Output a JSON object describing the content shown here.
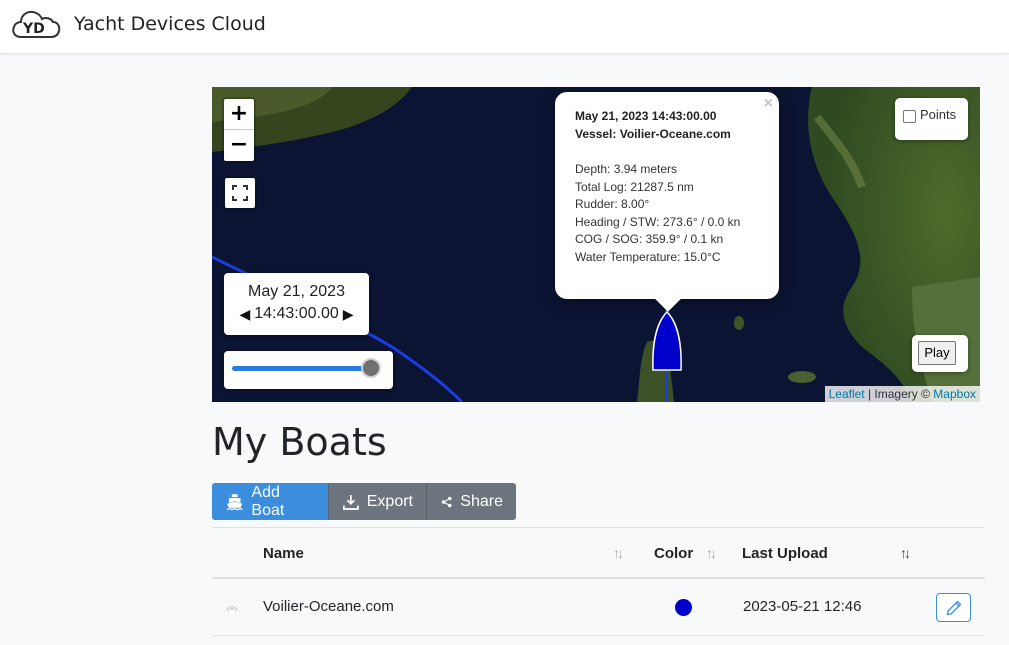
{
  "header": {
    "logo_text": "YD",
    "app_title": "Yacht Devices Cloud"
  },
  "map": {
    "zoom_in": "+",
    "zoom_out": "−",
    "time_control": {
      "date": "May 21, 2023",
      "time": "14:43:00.00",
      "prev": "◀",
      "next": "▶"
    },
    "slider": {
      "value_fraction": 1.0
    },
    "popup": {
      "close": "×",
      "datetime": "May 21, 2023 14:43:00.00",
      "vessel": "Vessel: Voilier-Oceane.com",
      "lines": [
        "Depth: 3.94 meters",
        "Total Log: 21287.5 nm",
        "Rudder: 8.00°",
        "Heading / STW: 273.6° / 0.0 kn",
        "COG / SOG: 359.9° / 0.1 kn",
        "Water Temperature: 15.0°C"
      ]
    },
    "points_label": "Points",
    "play_label": "Play",
    "attribution": {
      "leaflet": "Leaflet",
      "sep": " | Imagery © ",
      "mapbox": "Mapbox"
    },
    "boat_color": "#0000cc",
    "track_color": "#1a3de0"
  },
  "page_title": "My Boats",
  "toolbar": {
    "add_label": "Add Boat",
    "export_label": "Export",
    "share_label": "Share"
  },
  "table": {
    "columns": {
      "name": "Name",
      "color": "Color",
      "last_upload": "Last Upload"
    },
    "rows": [
      {
        "name": "Voilier-Oceane.com",
        "color": "#0000cc",
        "last_upload": "2023-05-21 12:46"
      }
    ]
  },
  "colors": {
    "primary": "#3b8ddd",
    "secondary": "#6c757d"
  }
}
